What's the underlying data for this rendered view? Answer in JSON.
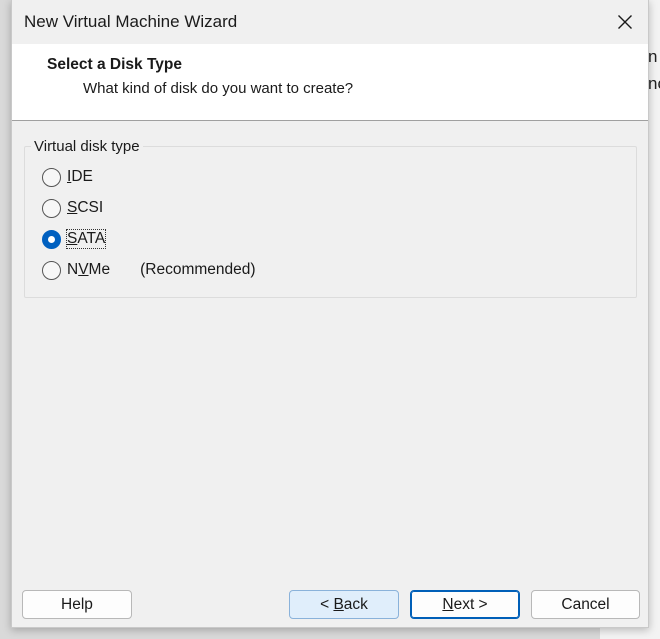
{
  "window": {
    "title": "New Virtual Machine Wizard",
    "close_icon": "close-icon"
  },
  "header": {
    "title": "Select a Disk Type",
    "subtitle": "What kind of disk do you want to create?"
  },
  "disk_type": {
    "legend": "Virtual disk type",
    "selected": "SATA",
    "options": [
      {
        "label_pre": "",
        "mnemonic": "I",
        "label_post": "DE",
        "checked": false,
        "note": ""
      },
      {
        "label_pre": "",
        "mnemonic": "S",
        "label_post": "CSI",
        "checked": false,
        "note": ""
      },
      {
        "label_pre": "",
        "mnemonic": "S",
        "label_post": "ATA",
        "checked": true,
        "note": ""
      },
      {
        "label_pre": "N",
        "mnemonic": "V",
        "label_post": "Me",
        "checked": false,
        "note": "(Recommended)"
      }
    ]
  },
  "buttons": {
    "help": "Help",
    "back_pre": "< ",
    "back_mn": "B",
    "back_post": "ack",
    "next_mn": "N",
    "next_post": "ext >",
    "cancel": "Cancel"
  },
  "background_fragments": [
    "n",
    "nc"
  ],
  "colors": {
    "accent": "#0060c0",
    "dialog_bg": "#f0f0f0",
    "header_bg": "#ffffff"
  }
}
